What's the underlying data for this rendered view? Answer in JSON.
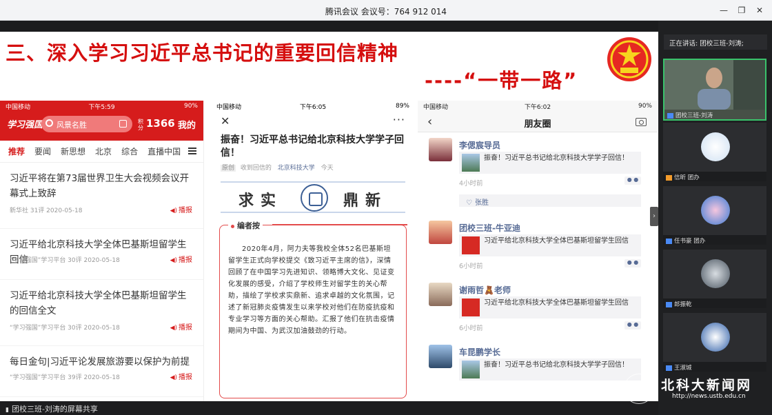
{
  "window": {
    "title": "腾讯会议 会议号：764 912 014"
  },
  "slide": {
    "title": "三、深入学习习近平总书记的重要回信精神",
    "subtitle": "----“一带一路”"
  },
  "phone1": {
    "carrier": "中国移动",
    "time": "下午5:59",
    "battery": "90%",
    "logo": "学习强国",
    "search_placeholder": "风景名胜",
    "score_label": "积分",
    "score": "1366",
    "mine": "我的",
    "tabs": [
      "推荐",
      "要闻",
      "新思想",
      "北京",
      "综合",
      "直播中国"
    ],
    "broadcast_label": "播报",
    "news": [
      {
        "title": "习近平将在第73届世界卫生大会视频会议开幕式上致辞",
        "meta": "新华社  31评  2020-05-18"
      },
      {
        "title": "习近平给北京科技大学全体巴基斯坦留学生回信",
        "meta": "“学习强国”学习平台  30评  2020-05-18"
      },
      {
        "title": "习近平给北京科技大学全体巴基斯坦留学生的回信全文",
        "meta": "“学习强国”学习平台  30评  2020-05-18"
      },
      {
        "title": "每日金句|习近平论发展旅游要以保护为前提",
        "meta": "“学习强国”学习平台  39评  2020-05-18"
      }
    ]
  },
  "phone2": {
    "carrier": "中国移动",
    "time": "下午6:05",
    "battery": "89%",
    "article_title": "振奋！习近平总书记给北京科技大学学子回信！",
    "meta_tag": "原创",
    "meta_from": "收到回信的",
    "meta_account": "北京科技大学",
    "meta_time": "今天",
    "motto_left": "求实",
    "motto_right": "鼎新",
    "editor_label": "编者按",
    "editor_text": "2020年4月，阿力夫等我校全体52名巴基斯坦留学生正式向学校提交《致习近平主席的信》，深情回顾了在中国学习先进知识、领略博大文化、见证变化发展的感受，介绍了学校师生对留学生的关心帮助，描绘了学校求实鼎新、追求卓越的文化氛围，记述了新冠肺炎疫情发生以来学校对他们在防疫抗疫和专业学习等方面的关心帮助。汇报了他们在抗击疫情期间为中国、为武汉加油鼓劲的行动。"
  },
  "phone3": {
    "carrier": "中国移动",
    "time": "下午6:02",
    "battery": "90%",
    "header_title": "朋友圈",
    "posts": [
      {
        "name": "李偲宸导员",
        "card_text": "振奋！习近平总书记给北京科技大学学子回信！",
        "time": "4小时前",
        "likes": "张胜"
      },
      {
        "name": "团校三班-牛亚迪",
        "card_text": "习近平给北京科技大学全体巴基斯坦留学生回信",
        "time": "6小时前"
      },
      {
        "name": "谢雨哲🧸老师",
        "card_text": "习近平给北京科技大学全体巴基斯坦留学生回信",
        "time": "6小时前"
      },
      {
        "name": "车昆鹏学长",
        "card_text": "振奋！习近平总书记给北京科技大学学子回信！",
        "time": ""
      }
    ]
  },
  "share_bar": {
    "label": "团校三班-刘涛的屏幕共享"
  },
  "participants": {
    "speaking": "正在讲话: 团校三班-刘涛;",
    "tiles": [
      {
        "name": "团校三班-刘涛"
      },
      {
        "name": "信昕 团办"
      },
      {
        "name": "任书豪 团办"
      },
      {
        "name": "郎振乾"
      },
      {
        "name": "王淑城"
      }
    ]
  },
  "watermark": {
    "name": "北科大新闻网",
    "url": "http://news.ustb.edu.cn"
  },
  "colors": {
    "accent_red": "#d50f0f",
    "xuexi_red": "#d61c1c",
    "wechat_link": "#576b95",
    "active_speaker": "#39c36b"
  }
}
